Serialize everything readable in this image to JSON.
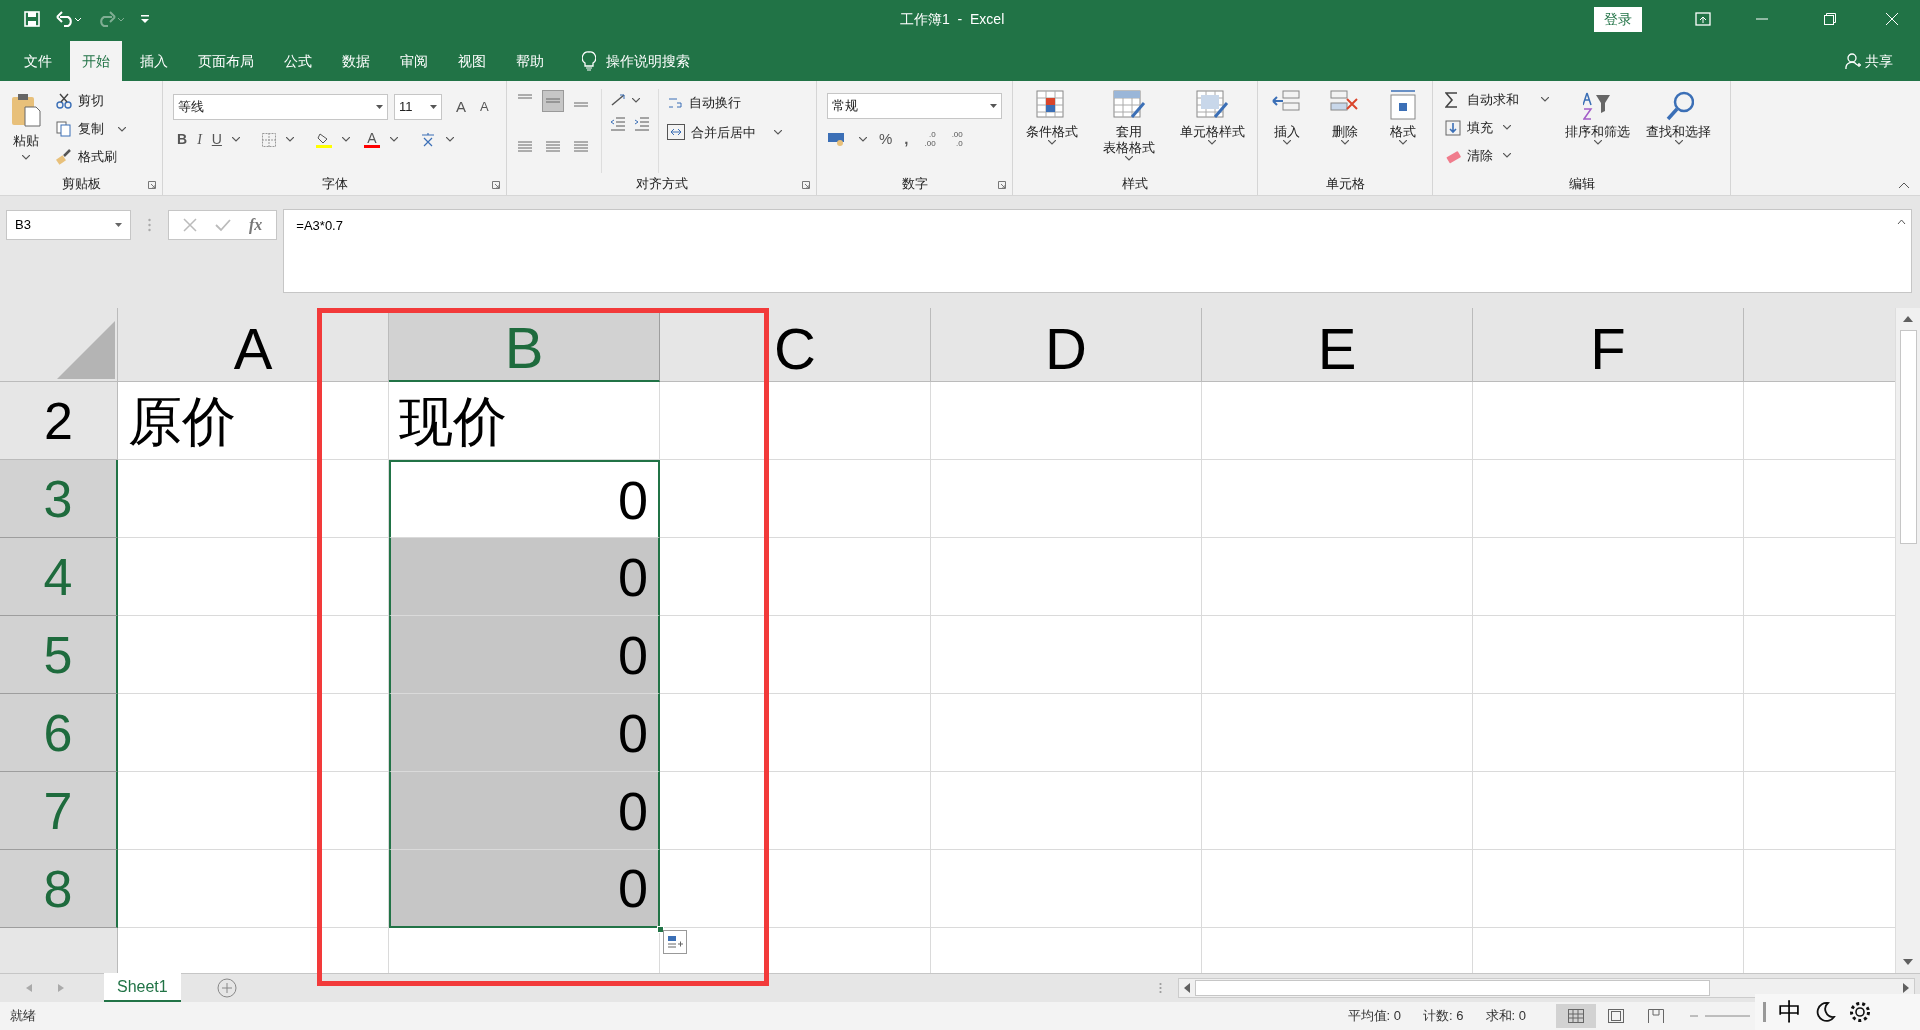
{
  "title_bar": {
    "title": "工作簿1  -  Excel",
    "signin": "登录"
  },
  "menu_tabs": [
    {
      "label": "文件",
      "selected": false
    },
    {
      "label": "开始",
      "selected": true
    },
    {
      "label": "插入",
      "selected": false
    },
    {
      "label": "页面布局",
      "selected": false
    },
    {
      "label": "公式",
      "selected": false
    },
    {
      "label": "数据",
      "selected": false
    },
    {
      "label": "审阅",
      "selected": false
    },
    {
      "label": "视图",
      "selected": false
    },
    {
      "label": "帮助",
      "selected": false
    }
  ],
  "tell_me": "操作说明搜索",
  "share": "共享",
  "clipboard": {
    "label": "剪贴板",
    "paste": "粘贴",
    "items": [
      "剪切",
      "复制",
      "格式刷"
    ]
  },
  "font": {
    "label": "字体",
    "font_name": "等线",
    "font_size": "11",
    "grow": "A",
    "shrink": "A",
    "bold": "B",
    "italic": "I",
    "underline": "U",
    "color_letter": "A"
  },
  "alignment": {
    "label": "对齐方式",
    "wrap": "自动换行",
    "merge": "合并后居中"
  },
  "number": {
    "label": "数字",
    "format": "常规",
    "percent": "%",
    "comma": ",",
    "increase": [
      ".0",
      ".00"
    ],
    "decrease": [
      ".00",
      ".0"
    ]
  },
  "styles": {
    "label": "样式",
    "items": [
      [
        "条件格式"
      ],
      [
        "套用",
        "表格格式"
      ],
      [
        "单元格样式"
      ]
    ]
  },
  "cells_group": {
    "label": "单元格",
    "items": [
      "插入",
      "删除",
      "格式"
    ]
  },
  "editing": {
    "label": "编辑",
    "items": [
      "自动求和",
      "填充",
      "清除"
    ],
    "big": [
      "排序和筛选",
      "查找和选择"
    ]
  },
  "formula_bar": {
    "name_box": "B3",
    "fx": "fx",
    "formula": "=A3*0.7"
  },
  "columns": [
    {
      "label": "A",
      "selected": false
    },
    {
      "label": "B",
      "selected": true
    },
    {
      "label": "C",
      "selected": false
    },
    {
      "label": "D",
      "selected": false
    },
    {
      "label": "E",
      "selected": false
    },
    {
      "label": "F",
      "selected": false
    }
  ],
  "rows": [
    {
      "header": "2",
      "selected": false,
      "cells": [
        {
          "text": "原价",
          "selected": false,
          "active": false
        },
        {
          "text": "现价",
          "selected": false,
          "active": false
        }
      ]
    },
    {
      "header": "3",
      "selected": true,
      "cells": [
        {
          "selected": false,
          "active": false
        },
        {
          "text": "0",
          "selected": true,
          "active": true
        }
      ]
    },
    {
      "header": "4",
      "selected": true,
      "cells": [
        {
          "selected": false,
          "active": false
        },
        {
          "text": "0",
          "selected": true,
          "active": false
        }
      ]
    },
    {
      "header": "5",
      "selected": true,
      "cells": [
        {
          "selected": false,
          "active": false
        },
        {
          "text": "0",
          "selected": true,
          "active": false
        }
      ]
    },
    {
      "header": "6",
      "selected": true,
      "cells": [
        {
          "selected": false,
          "active": false
        },
        {
          "text": "0",
          "selected": true,
          "active": false
        }
      ]
    },
    {
      "header": "7",
      "selected": true,
      "cells": [
        {
          "selected": false,
          "active": false
        },
        {
          "text": "0",
          "selected": true,
          "active": false
        }
      ]
    },
    {
      "header": "8",
      "selected": true,
      "cells": [
        {
          "selected": false,
          "active": false
        },
        {
          "text": "0",
          "selected": true,
          "active": false
        }
      ]
    }
  ],
  "sheet_tabs": [
    {
      "label": "Sheet1",
      "selected": true
    }
  ],
  "status_bar": {
    "ready": "就绪",
    "stats": [
      "平均值: 0",
      "计数: 6",
      "求和: 0"
    ],
    "views": [
      {
        "kind": "normal",
        "selected": true
      },
      {
        "kind": "page-layout",
        "selected": false
      },
      {
        "kind": "page-break",
        "selected": false
      }
    ],
    "ime": "中"
  }
}
